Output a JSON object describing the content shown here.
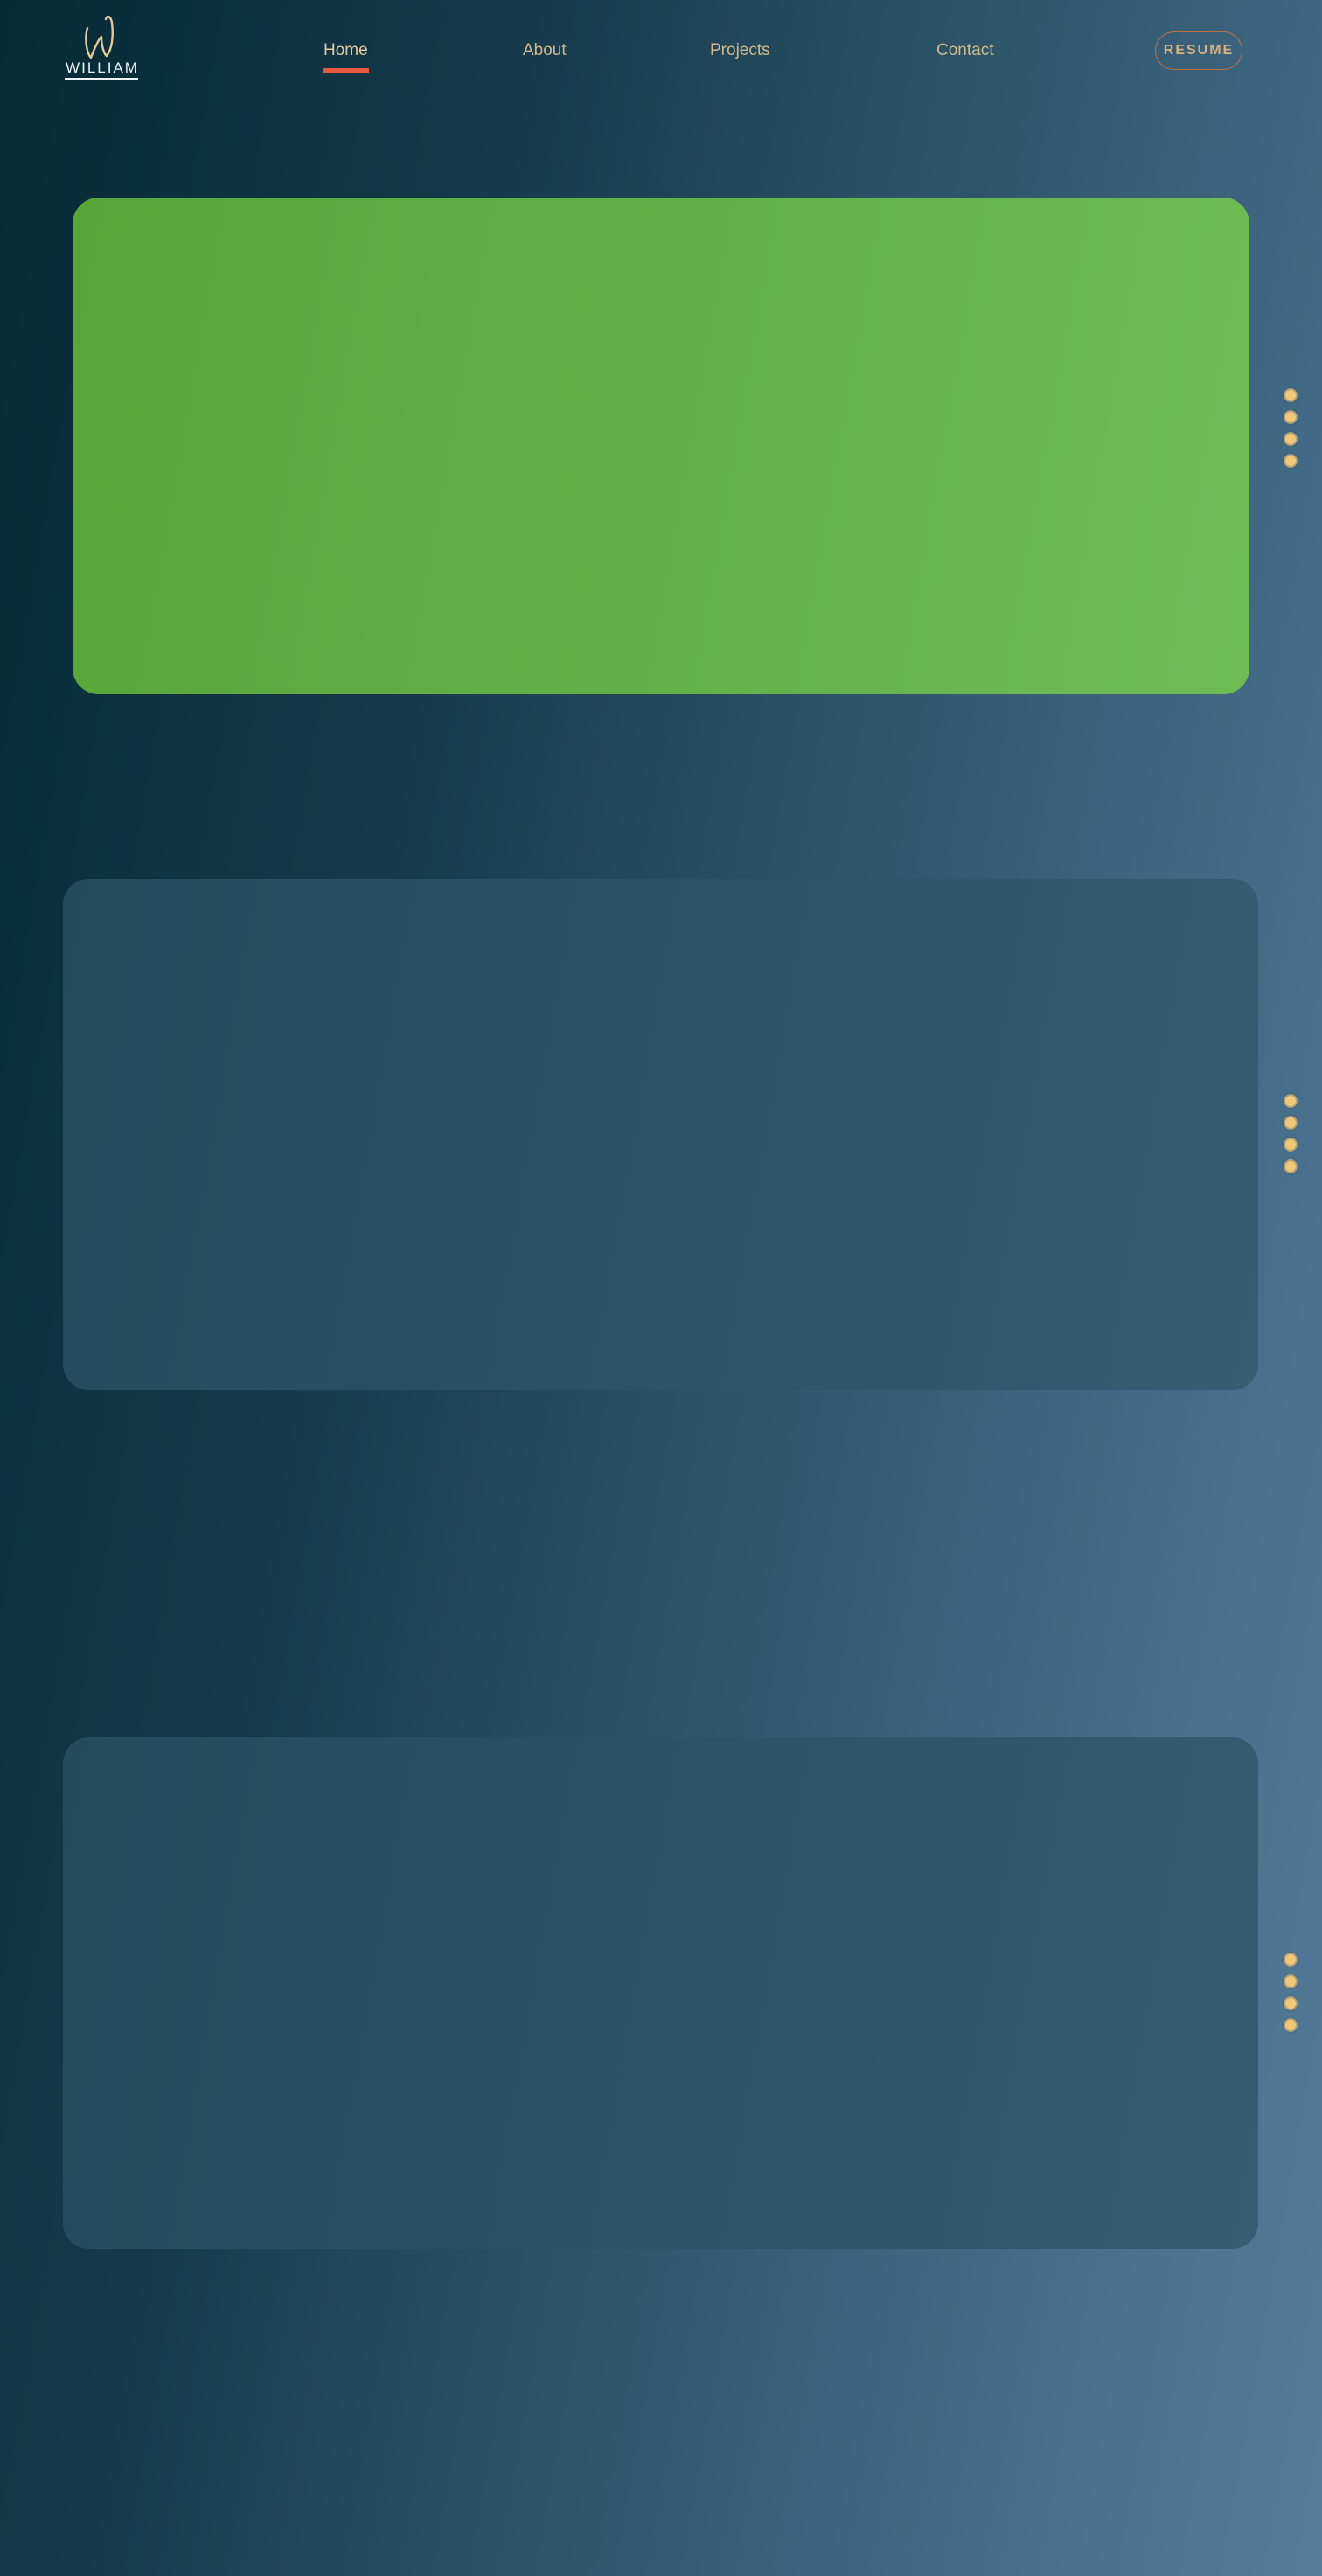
{
  "header": {
    "logo_text": "WILLIAM",
    "nav": [
      {
        "label": "Home",
        "active": true
      },
      {
        "label": "About",
        "active": false
      },
      {
        "label": "Projects",
        "active": false
      },
      {
        "label": "Contact",
        "active": false
      }
    ],
    "resume_label": "RESUME"
  },
  "colors": {
    "nav_text": "#d2b98a",
    "nav_active_indicator": "#e8593e",
    "resume_border": "#c7703f",
    "hero_card": "#63b048",
    "section_card": "#2a5366",
    "dot": "#f0c878"
  },
  "sections": [
    {
      "name": "hero",
      "dots": 4
    },
    {
      "name": "section-2",
      "dots": 4
    },
    {
      "name": "section-3",
      "dots": 4
    }
  ],
  "icons": {
    "logo": "signature-w-icon"
  }
}
